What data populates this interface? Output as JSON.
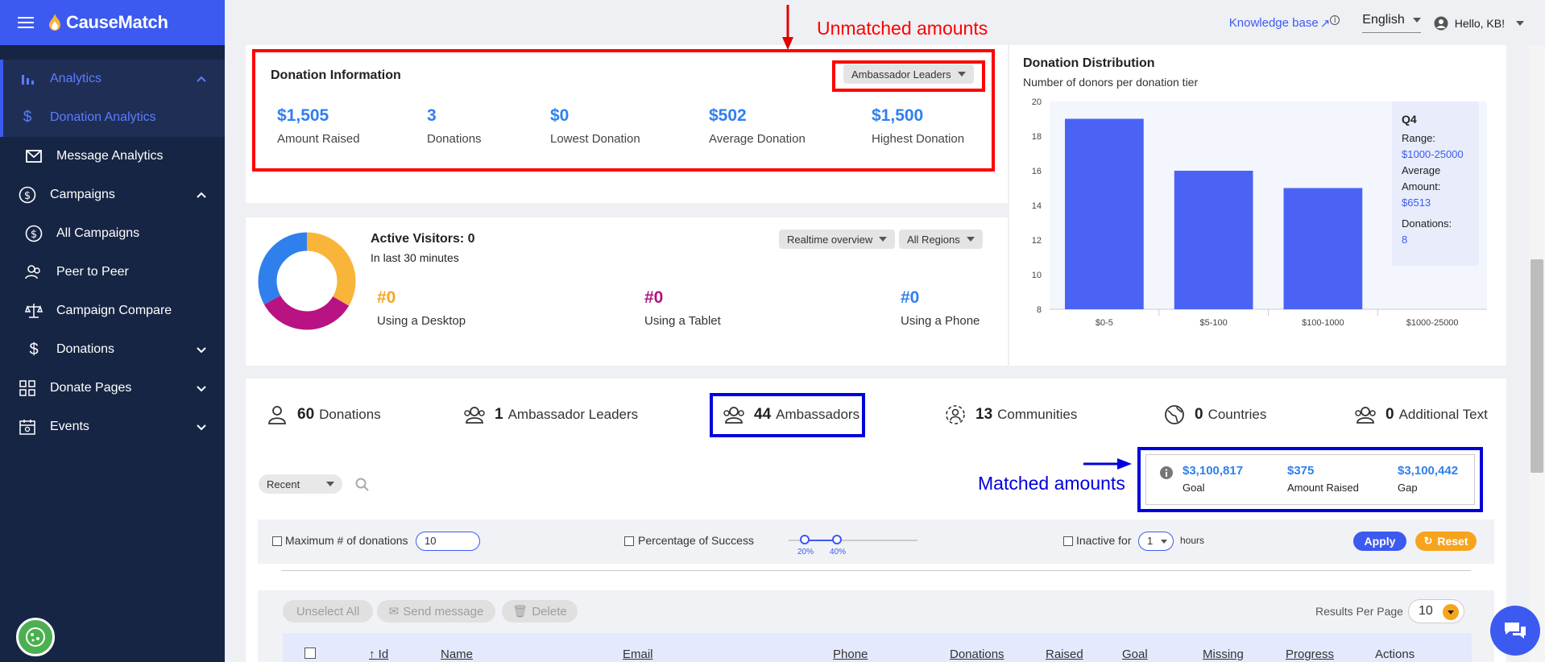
{
  "brand": {
    "name": "CauseMatch"
  },
  "sidebar": {
    "items": [
      {
        "label": "Analytics",
        "icon": "bar-chart-icon"
      },
      {
        "label": "Donation Analytics",
        "icon": "dollar-icon"
      },
      {
        "label": "Message Analytics",
        "icon": "envelope-icon"
      },
      {
        "label": "Campaigns",
        "icon": "dollar-circle-icon"
      },
      {
        "label": "All Campaigns",
        "icon": "dollar-circle-icon"
      },
      {
        "label": "Peer to Peer",
        "icon": "people-icon"
      },
      {
        "label": "Campaign Compare",
        "icon": "scale-icon"
      },
      {
        "label": "Donations",
        "icon": "dollar-icon"
      },
      {
        "label": "Donate Pages",
        "icon": "grid-icon"
      },
      {
        "label": "Events",
        "icon": "calendar-icon"
      }
    ]
  },
  "topbar": {
    "knowledge_base": "Knowledge base",
    "language": "English",
    "greeting": "Hello, KB!"
  },
  "donation_info": {
    "title": "Donation Information",
    "filter": "Ambassador Leaders",
    "stats": [
      {
        "value": "$1,505",
        "label": "Amount Raised"
      },
      {
        "value": "3",
        "label": "Donations"
      },
      {
        "value": "$0",
        "label": "Lowest Donation"
      },
      {
        "value": "$502",
        "label": "Average Donation"
      },
      {
        "value": "$1,500",
        "label": "Highest Donation"
      }
    ]
  },
  "annotations": {
    "unmatched": "Unmatched amounts",
    "matched": "Matched amounts"
  },
  "visitors": {
    "title": "Active Visitors: 0",
    "subtitle": "In last 30 minutes",
    "view_select": "Realtime overview",
    "region_select": "All Regions",
    "devices": [
      {
        "value": "#0",
        "label": "Using a Desktop",
        "color": "#f5a623"
      },
      {
        "value": "#0",
        "label": "Using a Tablet",
        "color": "#b0127e"
      },
      {
        "value": "#0",
        "label": "Using a Phone",
        "color": "#2f80ed"
      }
    ],
    "donut_colors": [
      "#f9b43a",
      "#b91282",
      "#2f80ed"
    ]
  },
  "distribution": {
    "title": "Donation Distribution",
    "subtitle": "Number of donors per donation tier",
    "tooltip": {
      "header": "Q4",
      "range_label": "Range:",
      "range_value": "$1000-25000",
      "avg_label_1": "Average",
      "avg_label_2": "Amount:",
      "avg_value": "$6513",
      "donations_label": "Donations:",
      "donations_value": "8"
    }
  },
  "chart_data": {
    "type": "bar",
    "title": "Donation Distribution",
    "subtitle": "Number of donors per donation tier",
    "categories": [
      "$0-5",
      "$5-100",
      "$100-1000",
      "$1000-25000"
    ],
    "values": [
      19,
      16,
      15,
      8
    ],
    "ylim": [
      8,
      20
    ],
    "yticks": [
      8,
      10,
      12,
      14,
      16,
      18,
      20
    ],
    "bar_color": "#4b63f5",
    "grid": false
  },
  "tabs": [
    {
      "count": "60",
      "label": "Donations",
      "icon": "person-icon"
    },
    {
      "count": "1",
      "label": "Ambassador Leaders",
      "icon": "group-icon"
    },
    {
      "count": "44",
      "label": "Ambassadors",
      "icon": "group-icon"
    },
    {
      "count": "13",
      "label": "Communities",
      "icon": "community-icon"
    },
    {
      "count": "0",
      "label": "Countries",
      "icon": "globe-icon"
    },
    {
      "count": "0",
      "label": "Additional Text",
      "icon": "group-icon"
    }
  ],
  "list_controls": {
    "sort": "Recent"
  },
  "matched": [
    {
      "value": "$3,100,817",
      "label": "Goal"
    },
    {
      "value": "$375",
      "label": "Amount Raised"
    },
    {
      "value": "$3,100,442",
      "label": "Gap"
    }
  ],
  "filters": {
    "max_donations_label": "Maximum # of donations",
    "max_donations_value": "10",
    "percentage_label": "Percentage of Success",
    "slider_low": "20%",
    "slider_high": "40%",
    "inactive_label": "Inactive for",
    "inactive_value": "1",
    "inactive_unit": "hours",
    "apply": "Apply",
    "reset": "Reset"
  },
  "bulk": {
    "unselect": "Unselect All",
    "send": "Send message",
    "delete": "Delete",
    "results_label": "Results Per Page",
    "results_value": "10"
  },
  "table": {
    "columns": [
      "Id",
      "Name",
      "Email",
      "Phone",
      "Donations",
      "Raised",
      "Goal",
      "Missing",
      "Progress",
      "Actions"
    ]
  }
}
